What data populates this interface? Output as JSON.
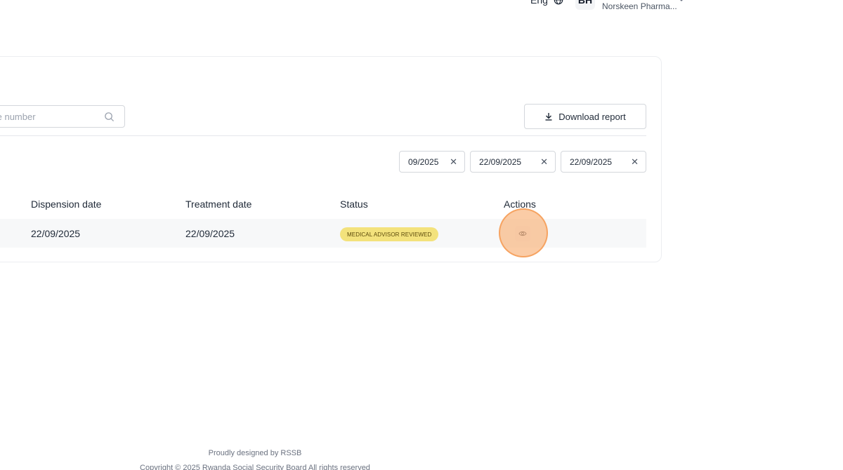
{
  "header": {
    "language": "Eng",
    "avatar_initials": "BH",
    "organization": "Norskeen Pharma..."
  },
  "toolbar": {
    "search_placeholder": "liate number",
    "download_label": "Download report"
  },
  "filters": [
    {
      "value": "09/2025",
      "clear": "✕"
    },
    {
      "value": "22/09/2025",
      "clear": "✕"
    },
    {
      "value": "22/09/2025",
      "clear": "✕"
    }
  ],
  "table": {
    "headers": [
      "Dispension date",
      "Treatment date",
      "Status",
      "Actions"
    ],
    "rows": [
      {
        "dispension_date": "22/09/2025",
        "treatment_date": "22/09/2025",
        "status": "MEDICAL ADVISOR REVIEWED"
      }
    ]
  },
  "footer": {
    "credit": "Proudly designed by RSSB",
    "copyright": "Copyright © 2025 Rwanda Social Security Board All rights reserved"
  },
  "colors": {
    "status_badge_bg": "#f3e27c",
    "click_highlight": "#f9b077"
  }
}
